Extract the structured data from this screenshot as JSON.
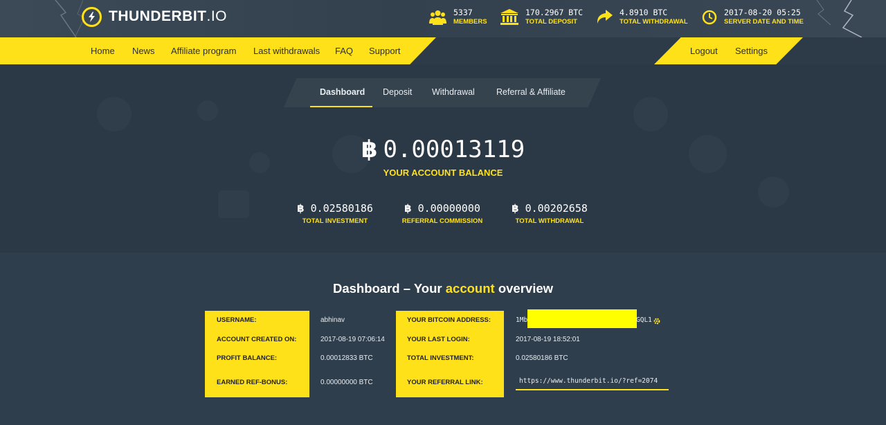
{
  "header": {
    "logo_bold": "THUNDERBIT",
    "logo_thin": ".IO",
    "stats": [
      {
        "icon": "users-icon",
        "value": "5337",
        "label": "MEMBERS"
      },
      {
        "icon": "bank-icon",
        "value": "170.2967 BTC",
        "label": "TOTAL DEPOSIT"
      },
      {
        "icon": "share-arrow-icon",
        "value": "4.8910 BTC",
        "label": "TOTAL WITHDRAWAL"
      },
      {
        "icon": "clock-icon",
        "value": "2017-08-20 05:25",
        "label": "SERVER DATE AND TIME"
      }
    ]
  },
  "nav": {
    "left": [
      "Home",
      "News",
      "Affiliate program",
      "Last withdrawals",
      "FAQ",
      "Support"
    ],
    "right": [
      "Logout",
      "Settings"
    ]
  },
  "tabs": [
    "Dashboard",
    "Deposit",
    "Withdrawal",
    "Referral & Affiliate"
  ],
  "balance": {
    "symbol": "฿",
    "value": "0.00013119",
    "label": "YOUR ACCOUNT BALANCE"
  },
  "substats": [
    {
      "value": "0.02580186",
      "label": "TOTAL INVESTMENT"
    },
    {
      "value": "0.00000000",
      "label": "REFERRAL COMMISSION"
    },
    {
      "value": "0.00202658",
      "label": "TOTAL WITHDRAWAL"
    }
  ],
  "overview": {
    "title_pre": "Dashboard – Your ",
    "title_hl": "account",
    "title_post": " overview"
  },
  "account_left": [
    {
      "label": "USERNAME:",
      "value": "abhinav"
    },
    {
      "label": "ACCOUNT CREATED ON:",
      "value": "2017-08-19 07:06:14"
    },
    {
      "label": "PROFIT BALANCE:",
      "value": "0.00012833 BTC"
    },
    {
      "label": "EARNED REF-BONUS:",
      "value": "0.00000000 BTC"
    }
  ],
  "account_right": [
    {
      "label": "YOUR BITCOIN ADDRESS:",
      "value_start": "1Mb",
      "value_end": "GQL1"
    },
    {
      "label": "YOUR LAST LOGIN:",
      "value": "2017-08-19 18:52:01"
    },
    {
      "label": "TOTAL INVESTMENT:",
      "value": "0.02580186 BTC"
    },
    {
      "label": "YOUR REFERRAL LINK:",
      "value": "https://www.thunderbit.io/?ref=2074"
    }
  ],
  "colors": {
    "accent": "#ffe11a",
    "bg": "#2f3e4d",
    "hero": "#2b3845"
  }
}
